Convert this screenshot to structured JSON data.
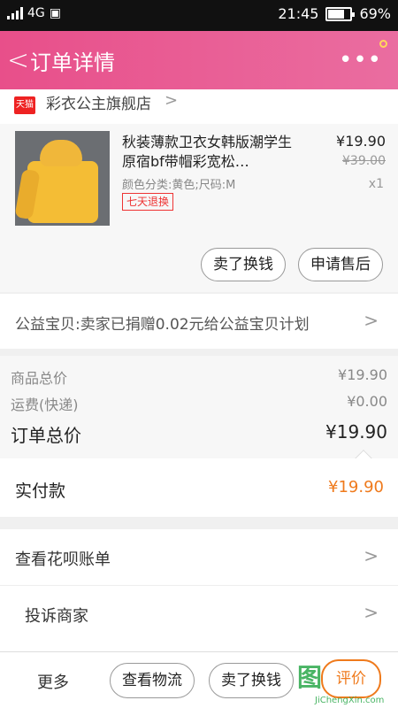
{
  "status": {
    "network": "4G",
    "time": "21:45",
    "battery": "69%"
  },
  "nav": {
    "back": "<",
    "title": "订单详情",
    "more": "•••"
  },
  "store": {
    "badge": "天猫",
    "name": "彩衣公主旗舰店",
    "chevron": ">"
  },
  "product": {
    "title": "秋装薄款卫衣女韩版潮学生原宿bf带帽彩宽松…",
    "spec": "颜色分类:黄色;尺码:M",
    "badge": "七天退换",
    "price": "¥19.90",
    "old_price": "¥39.00",
    "qty": "x1",
    "button_sell": "卖了换钱",
    "button_aftersale": "申请售后"
  },
  "charity": {
    "text": "公益宝贝:卖家已捐赠0.02元给公益宝贝计划",
    "chevron": ">"
  },
  "summary": {
    "goods_label": "商品总价",
    "goods_value": "¥19.90",
    "shipping_label": "运费(快递)",
    "shipping_value": "¥0.00",
    "total_label": "订单总价",
    "total_value": "¥19.90"
  },
  "paid": {
    "label": "实付款",
    "value": "¥19.90"
  },
  "menu": {
    "item1": "查看花呗账单",
    "item2": "投诉商家",
    "chevron": ">"
  },
  "bottom": {
    "more": "更多",
    "logistics": "查看物流",
    "sell": "卖了换钱",
    "review": "评价"
  },
  "watermark": {
    "char": "图",
    "url": "JiChengXin.com"
  },
  "colors": {
    "accent": "#e84f8a",
    "orange": "#ef7a1c"
  }
}
